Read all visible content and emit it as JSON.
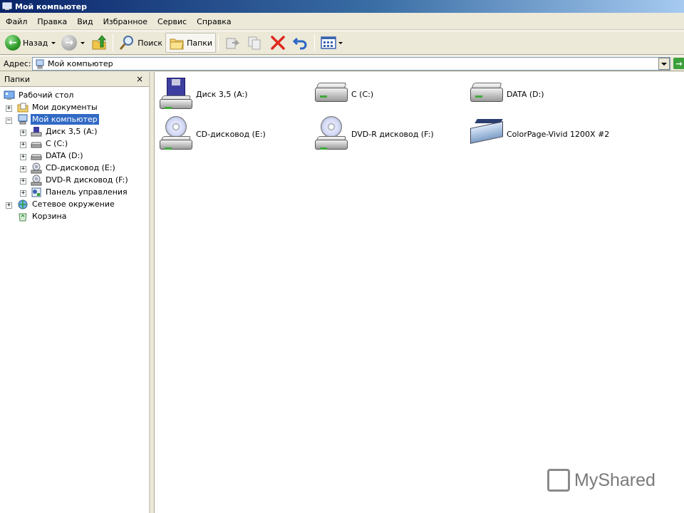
{
  "window": {
    "title": "Мой компьютер"
  },
  "menu": [
    "Файл",
    "Правка",
    "Вид",
    "Избранное",
    "Сервис",
    "Справка"
  ],
  "toolbar": {
    "back_label": "Назад",
    "search_label": "Поиск",
    "folders_label": "Папки"
  },
  "address": {
    "label": "Адрес:",
    "value": "Мой компьютер"
  },
  "folders_pane": {
    "title": "Папки",
    "close": "×",
    "tree": [
      {
        "label": "Рабочий стол",
        "level": 0,
        "expander": "",
        "icon": "desktop-icon"
      },
      {
        "label": "Мои документы",
        "level": 1,
        "expander": "+",
        "icon": "my-documents-icon"
      },
      {
        "label": "Мой компьютер",
        "level": 1,
        "expander": "−",
        "icon": "my-computer-icon",
        "selected": true
      },
      {
        "label": "Диск 3,5 (A:)",
        "level": 2,
        "expander": "+",
        "icon": "floppy-drive-icon"
      },
      {
        "label": "C (C:)",
        "level": 2,
        "expander": "+",
        "icon": "hard-drive-icon"
      },
      {
        "label": "DATA (D:)",
        "level": 2,
        "expander": "+",
        "icon": "hard-drive-icon"
      },
      {
        "label": "CD-дисковод (E:)",
        "level": 2,
        "expander": "+",
        "icon": "cd-drive-icon"
      },
      {
        "label": "DVD-R дисковод (F:)",
        "level": 2,
        "expander": "+",
        "icon": "dvd-drive-icon"
      },
      {
        "label": "Панель управления",
        "level": 2,
        "expander": "+",
        "icon": "control-panel-icon"
      },
      {
        "label": "Сетевое окружение",
        "level": 1,
        "expander": "+",
        "icon": "network-places-icon"
      },
      {
        "label": "Корзина",
        "level": 1,
        "expander": "",
        "icon": "recycle-bin-icon"
      }
    ]
  },
  "content": {
    "items": [
      {
        "label": "Диск 3,5 (A:)",
        "icon": "floppy-drive-icon"
      },
      {
        "label": "C (C:)",
        "icon": "hard-drive-icon"
      },
      {
        "label": "DATA (D:)",
        "icon": "hard-drive-icon"
      },
      {
        "label": "CD-дисковод (E:)",
        "icon": "cd-drive-icon"
      },
      {
        "label": "DVD-R дисковод (F:)",
        "icon": "dvd-drive-icon"
      },
      {
        "label": "ColorPage-Vivid 1200X #2",
        "icon": "scanner-icon"
      }
    ]
  },
  "watermark": {
    "text": "MyShared"
  }
}
